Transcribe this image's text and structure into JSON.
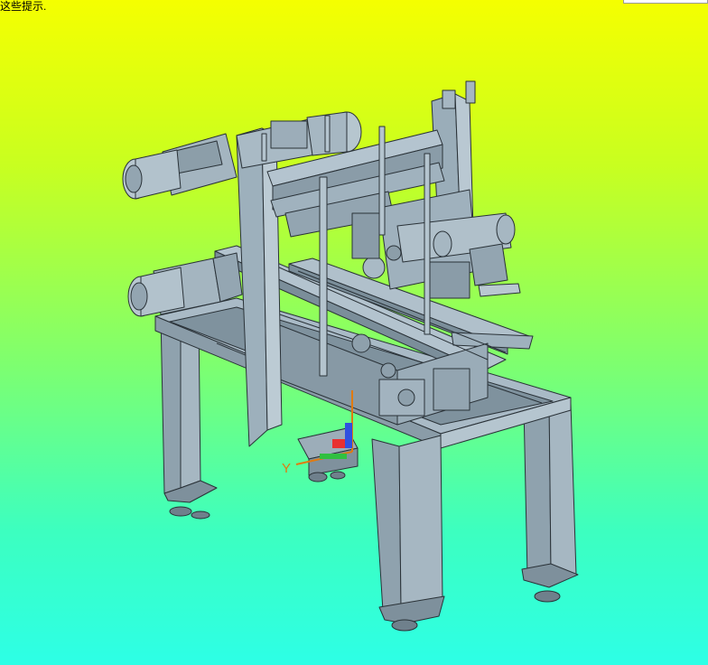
{
  "hint_text": "这些提示.",
  "triad": {
    "y_label": "Y"
  },
  "colors": {
    "model": "#95a8b5",
    "edge": "#2a3238",
    "accent_x": "#e83030",
    "accent_z": "#3050e0",
    "accent_y": "#30c040"
  }
}
